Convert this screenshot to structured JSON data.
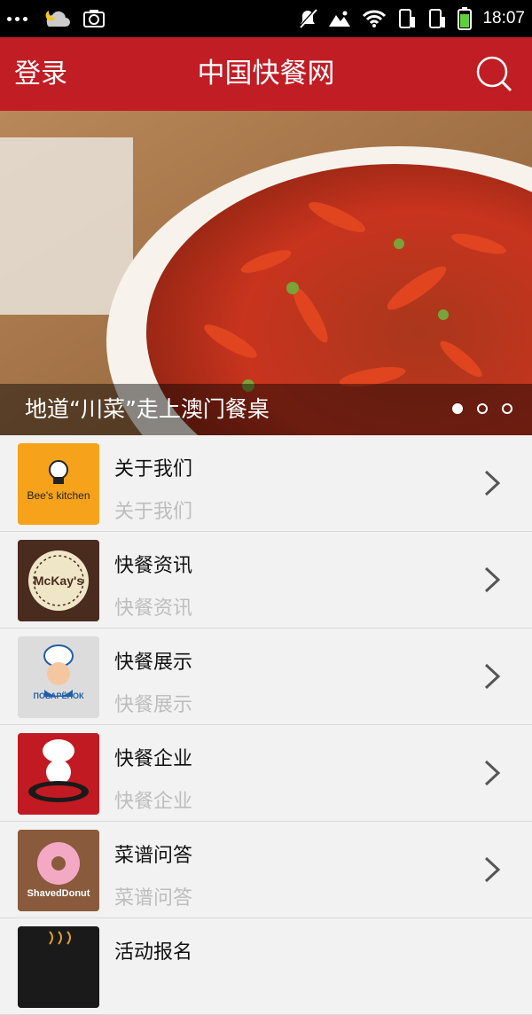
{
  "status_bar": {
    "time": "18:07"
  },
  "header": {
    "login_label": "登录",
    "title": "中国快餐网"
  },
  "banner": {
    "caption": "地道“川菜”走上澳门餐桌",
    "slides": 3,
    "active_slide": 1
  },
  "list": [
    {
      "title": "关于我们",
      "subtitle": "关于我们",
      "logo_text": "Bee's kitchen",
      "logo_bg": "#f7a21b"
    },
    {
      "title": "快餐资讯",
      "subtitle": "快餐资讯",
      "logo_text": "McKay's",
      "logo_bg": "#4a2c1f"
    },
    {
      "title": "快餐展示",
      "subtitle": "快餐展示",
      "logo_text": "ПОВАРЁНОК",
      "logo_bg": "#dcdcdc"
    },
    {
      "title": "快餐企业",
      "subtitle": "快餐企业",
      "logo_text": "",
      "logo_bg": "#c21a22"
    },
    {
      "title": "菜谱问答",
      "subtitle": "菜谱问答",
      "logo_text": "ShavedDonut",
      "logo_bg": "#8a5a3c"
    },
    {
      "title": "活动报名",
      "subtitle": "",
      "logo_text": "",
      "logo_bg": "#1a1a1a"
    }
  ],
  "colors": {
    "header": "#c11d25",
    "background": "#f2f2f2"
  }
}
